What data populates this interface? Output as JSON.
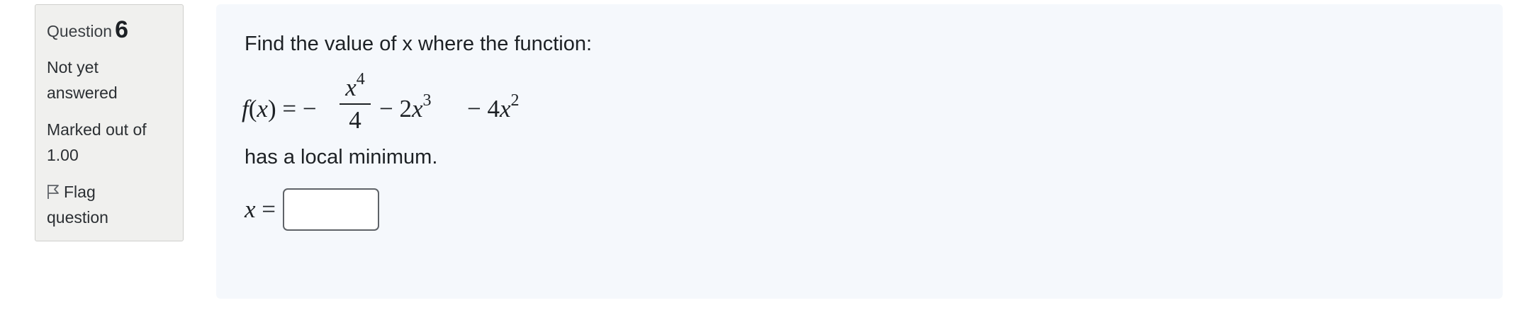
{
  "question_info": {
    "label": "Question",
    "number": "6",
    "state": "Not yet answered",
    "grade": "Marked out of 1.00",
    "flag_label": "Flag question",
    "flag_icon": "flag-outline-icon"
  },
  "question": {
    "text_before": "Find the value of x where the function:",
    "formula": {
      "lhs": "f(x) = −",
      "frac_num_base": "x",
      "frac_num_exp": "4",
      "frac_den": "4",
      "term2_prefix": "− 2",
      "term2_var": "x",
      "term2_exp": "3",
      "term3_prefix": "− 4",
      "term3_var": "x",
      "term3_exp": "2"
    },
    "text_after": "has a local minimum.",
    "answer_var": "x",
    "answer_eq": " =",
    "answer_value": "",
    "answer_placeholder": ""
  }
}
